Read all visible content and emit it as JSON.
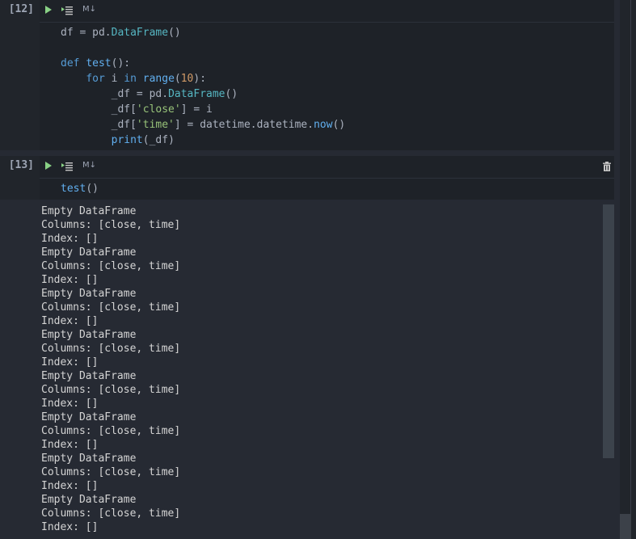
{
  "cells": [
    {
      "execution_count": "[12]",
      "toolbar": {
        "markdown_label": "M↓"
      },
      "code": {
        "line1": {
          "a": "df = pd.",
          "b": "DataFrame",
          "c": "()"
        },
        "line2": "",
        "line3": {
          "kw": "def",
          "sp": " ",
          "fn": "test",
          "rest": "():"
        },
        "line4": {
          "indent": "    ",
          "kw1": "for",
          "mid": " i ",
          "kw2": "in",
          "sp": " ",
          "fn": "range",
          "p1": "(",
          "num": "10",
          "p2": "):"
        },
        "line5": {
          "a": "        _df = pd.",
          "cls": "DataFrame",
          "c": "()"
        },
        "line6": {
          "a": "        _df[",
          "str": "'close'",
          "c": "] = i"
        },
        "line7": {
          "a": "        _df[",
          "str": "'time'",
          "c": "] = datetime.datetime.",
          "fn": "now",
          "d": "()"
        },
        "line8": {
          "indent": "        ",
          "fn": "print",
          "rest": "(_df)"
        }
      }
    },
    {
      "execution_count": "[13]",
      "toolbar": {
        "markdown_label": "M↓"
      },
      "code": {
        "fn": "test",
        "rest": "()"
      }
    }
  ],
  "output": {
    "text": "Empty DataFrame\nColumns: [close, time]\nIndex: []\nEmpty DataFrame\nColumns: [close, time]\nIndex: []\nEmpty DataFrame\nColumns: [close, time]\nIndex: []\nEmpty DataFrame\nColumns: [close, time]\nIndex: []\nEmpty DataFrame\nColumns: [close, time]\nIndex: []\nEmpty DataFrame\nColumns: [close, time]\nIndex: []\nEmpty DataFrame\nColumns: [close, time]\nIndex: []\nEmpty DataFrame\nColumns: [close, time]\nIndex: []"
  },
  "icons": {
    "run": "run-cell-icon",
    "run_all": "run-by-line-icon",
    "delete": "trash-icon"
  },
  "colors": {
    "background": "#262a33",
    "keyword": "#569cd6",
    "function": "#61afef",
    "class": "#56b6c2",
    "number": "#d19a66",
    "string": "#98c379",
    "run_icon": "#89d185"
  }
}
